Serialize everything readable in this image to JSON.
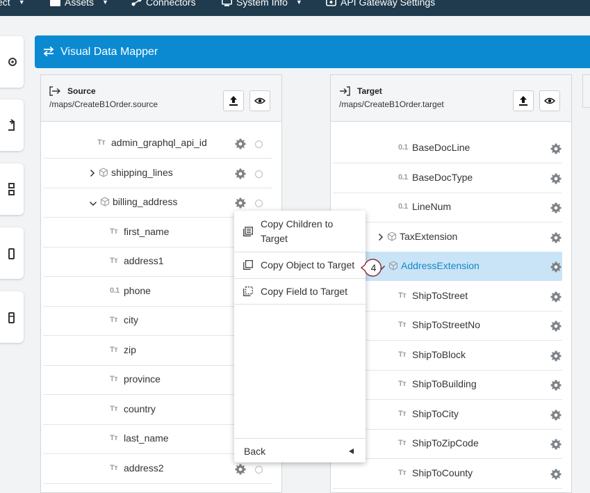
{
  "nav": {
    "items": [
      {
        "label": "ect",
        "icon": "project-icon"
      },
      {
        "label": "Assets",
        "icon": "assets-icon"
      },
      {
        "label": "Connectors",
        "icon": "connectors-icon"
      },
      {
        "label": "System Info",
        "icon": "monitor-icon"
      },
      {
        "label": "API Gateway Settings",
        "icon": "api-gateway-icon"
      }
    ]
  },
  "header": {
    "title": "Visual Data Mapper",
    "icon": "swap-arrows-icon"
  },
  "source": {
    "title": "Source",
    "path": "/maps/CreateB1Order.source",
    "rows": [
      {
        "label": "admin_graphql_api_id",
        "type": "text"
      },
      {
        "label": "shipping_lines",
        "type": "object",
        "expand": "collapsed"
      },
      {
        "label": "billing_address",
        "type": "object",
        "expand": "expanded"
      },
      {
        "label": "first_name",
        "type": "text"
      },
      {
        "label": "address1",
        "type": "text"
      },
      {
        "label": "phone",
        "type": "number"
      },
      {
        "label": "city",
        "type": "text"
      },
      {
        "label": "zip",
        "type": "text"
      },
      {
        "label": "province",
        "type": "text"
      },
      {
        "label": "country",
        "type": "text"
      },
      {
        "label": "last_name",
        "type": "text"
      },
      {
        "label": "address2",
        "type": "text"
      }
    ]
  },
  "target": {
    "title": "Target",
    "path": "/maps/CreateB1Order.target",
    "rows": [
      {
        "label": "BaseDocLine",
        "type": "number"
      },
      {
        "label": "BaseDocType",
        "type": "number"
      },
      {
        "label": "LineNum",
        "type": "number"
      },
      {
        "label": "TaxExtension",
        "type": "object",
        "expand": "collapsed"
      },
      {
        "label": "AddressExtension",
        "type": "object",
        "expand": "expanded",
        "selected": true
      },
      {
        "label": "ShipToStreet",
        "type": "text"
      },
      {
        "label": "ShipToStreetNo",
        "type": "text"
      },
      {
        "label": "ShipToBlock",
        "type": "text"
      },
      {
        "label": "ShipToBuilding",
        "type": "text"
      },
      {
        "label": "ShipToCity",
        "type": "text"
      },
      {
        "label": "ShipToZipCode",
        "type": "text"
      },
      {
        "label": "ShipToCounty",
        "type": "text"
      }
    ]
  },
  "type_glyphs": {
    "text": "Tт",
    "number": "0.1"
  },
  "menu": {
    "items": [
      {
        "label": "Copy Children to Target",
        "icon": "copy-children-icon"
      },
      {
        "label": "Copy Object to Target",
        "icon": "copy-object-icon"
      },
      {
        "label": "Copy Field to Target",
        "icon": "copy-field-icon"
      }
    ],
    "back_label": "Back"
  },
  "step_badge": "4",
  "colors": {
    "nav_bg": "#1f3b4d",
    "header_bg": "#0b8ad1",
    "selected_row": "#c9e4f6",
    "selected_text": "#1586c9"
  }
}
